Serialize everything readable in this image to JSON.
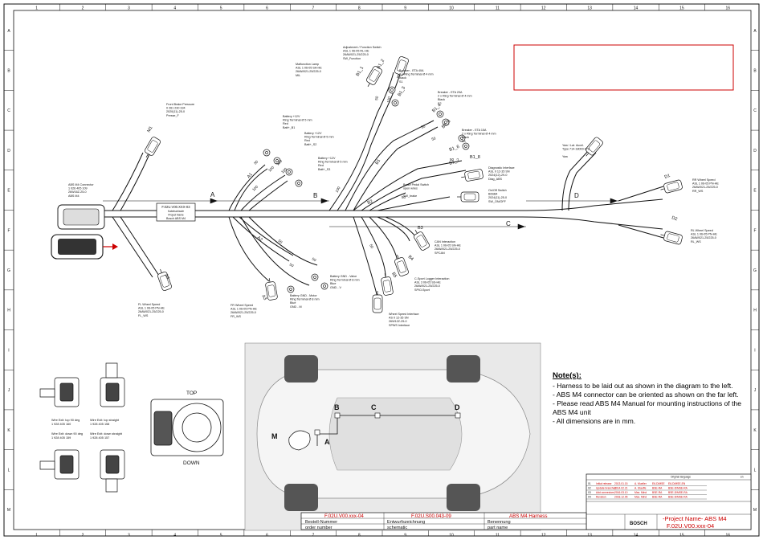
{
  "frame": {
    "columns": [
      "1",
      "2",
      "3",
      "4",
      "5",
      "6",
      "7",
      "8",
      "9",
      "10",
      "11",
      "12",
      "13",
      "14",
      "15",
      "16"
    ],
    "rows": [
      "A",
      "B",
      "C",
      "D",
      "E",
      "F",
      "G",
      "H",
      "I",
      "J",
      "K",
      "L",
      "M"
    ]
  },
  "connectors": {
    "abs": [
      "ABS M4 Connector",
      "1 026 405 109",
      "26W16Z-25-0",
      "ABS M4"
    ],
    "front_brake": [
      "Front Brake Pressure",
      "0 261 230 334",
      "2020(11)-25-0",
      "Presse_F"
    ],
    "malfunction": [
      "Malfunction Lamp",
      "ASL 1 06-05 SA-HE",
      "26AW021-25/225-0",
      "MIL"
    ],
    "adjust": [
      "Adjustment / Function Switch",
      "ASL 1 06-05 RL-HE",
      "26AW021-25/225-0",
      "SW_Function"
    ],
    "breaker1": [
      "Breaker - ETA 40A",
      "2 x Ring Terminal Ø 4 mm",
      "Black",
      "S1"
    ],
    "breaker2": [
      "Breaker - ETA 20A",
      "2 x Ring Terminal Ø 4 mm",
      "Black",
      "S2"
    ],
    "breaker3": [
      "Breaker - ETA 15A",
      "2 x Ring Terminal Ø 4 mm",
      "Black",
      "S3"
    ],
    "batt1": [
      "Battery +12V",
      "Ring Terminal Ø 5 mm",
      "Red",
      "Batt+_B1"
    ],
    "batt2": [
      "Battery +12V",
      "Ring Terminal Ø 5 mm",
      "Red",
      "Batt+_S2"
    ],
    "batt3": [
      "Battery +12V",
      "Ring Terminal Ø 5 mm",
      "Red",
      "Batt+_S3"
    ],
    "yaw": [
      "Yaw / Lat. Accel.",
      "Type 714-18000-078",
      "",
      "Yaw"
    ],
    "diag": [
      "Diagnostic Interface",
      "ASL 0 12-35 SN",
      "2024(12)-29-0",
      "Diag_ABS"
    ],
    "onoff": [
      "On/Off Switch",
      "B6SB4",
      "2024(11)-25-0",
      "SW_ON/OFF"
    ],
    "brake_pedal": [
      "Brake Pedal Switch",
      "open wires",
      "",
      "SW_brake"
    ],
    "rr": [
      "RR Wheel Speed",
      "ASL 1 06-05 PN-HE",
      "26AW021-25/225-0",
      "RR_WS"
    ],
    "rl": [
      "RL Wheel Speed",
      "ASL 1 06-05 PN-HE",
      "26AW021-25/225-0",
      "RL_WS"
    ],
    "can": [
      "CAN Interaction",
      "ASL 1 06-05 SN-HE",
      "26AW021-25/225-0",
      "SPCAN"
    ],
    "logger": [
      "C-Sport Logger Interaction",
      "ASL 3 06-05 SS-HE",
      "26AW021-25/225-0",
      "SPIO-Sport"
    ],
    "wheel_if": [
      "Wheel Speed Interface",
      "AS 0 12-35 SN",
      "26W12Z-25-0",
      "SPWS Interface"
    ],
    "batt_gnd_v": [
      "Battery GND - Valve",
      "Ring Terminal Ø 8 mm",
      "Blue",
      "GND - V"
    ],
    "batt_gnd_m": [
      "Battery GND - Motor",
      "Ring Terminal Ø 8 mm",
      "Blue",
      "GND - M"
    ],
    "fr": [
      "FR Wheel Speed",
      "ASL 1 06-05 PN-HE",
      "26AW021-25/225-0",
      "FR_WS"
    ],
    "fl": [
      "FL Wheel Speed",
      "ASL 1 06-05 PN-HE",
      "26AW021-25/225-0",
      "FL_WS"
    ]
  },
  "label_box": [
    "F.02U.V00.XXX-03",
    "Kabelschlaufe",
    "Project Name",
    "Bosch ABS M4"
  ],
  "segments": [
    "A",
    "B",
    "C",
    "D"
  ],
  "branch_tags": [
    "M1",
    "B1_1",
    "B1_2",
    "B1_3",
    "B1_4",
    "B1_5",
    "B1_6",
    "B1_7",
    "B1",
    "B2",
    "B3",
    "B4",
    "B5",
    "D1",
    "D2",
    "A1",
    "A2",
    "A3",
    "A4",
    "B1_8"
  ],
  "lengths": [
    "50",
    "100",
    "100",
    "100",
    "50",
    "100",
    "50",
    "50",
    "50",
    "50",
    "50",
    "50",
    "50",
    "100",
    "100",
    "50"
  ],
  "car_labels": [
    "B",
    "C",
    "D",
    "M",
    "A"
  ],
  "orient": {
    "top": "TOP",
    "down": "DOWN",
    "wire_up90": [
      "Wire Exit: top 90 deg",
      "1 928 405 160"
    ],
    "wire_upstraight": [
      "Wire Exit: top straight",
      "1 928 405 158"
    ],
    "wire_down90": [
      "Wire Exit: down 90 deg",
      "1 928 405 159"
    ],
    "wire_downstraight": [
      "Wire Exit: down straight",
      "1 928 405 157"
    ]
  },
  "notes": {
    "title": "Note(s):",
    "lines": [
      "- Harness to be laid out as shown in the diagram to the left.",
      "- ABS M4 connector can be oriented as shown on the far left.",
      "- Please read ABS M4 Manual for mounting instructions of the ABS M4 unit",
      "- All dimensions are in mm."
    ]
  },
  "title_block": {
    "order_number_value": "F.02U.V00.xxx-04",
    "order_number_de": "Bestell-Nummer",
    "order_number_en": "order number",
    "schematic_value": "F.02U.S00.043-09",
    "schematic_de": "Entwurfszeichnung",
    "schematic_en": "schematic",
    "part_value": "ABS M4 Harness",
    "part_de": "Benennung",
    "part_en": "part name",
    "brand": "BOSCH",
    "project": "-Project Name- ABS M4",
    "code": "F.02U.V00.xxx-04",
    "original_language": "Original language",
    "language_value": "en",
    "revision_rows": [
      [
        "01",
        "Initial release",
        "2013.01.15",
        "A. Mueller",
        "E6-D/MSE",
        "E6-D/MSE-EN"
      ],
      [
        "02",
        "Update branches",
        "2014.02.21",
        "A. Stauffe",
        "BSE-RA",
        "BSE-D/MSE-RA"
      ],
      [
        "03",
        "Add connectors",
        "2016.03.10",
        "Max. Mind",
        "BSE-RA",
        "BSE-D/MSE-RA"
      ],
      [
        "04",
        "Revision",
        "2018.12.05",
        "Max. Mind",
        "BSE-RA",
        "BSE-D/MSE-RA"
      ]
    ]
  },
  "colors": {
    "line": "#111111",
    "accent": "#cc0000",
    "car": "#d9d9d9",
    "panel": "#e9e9e9"
  }
}
